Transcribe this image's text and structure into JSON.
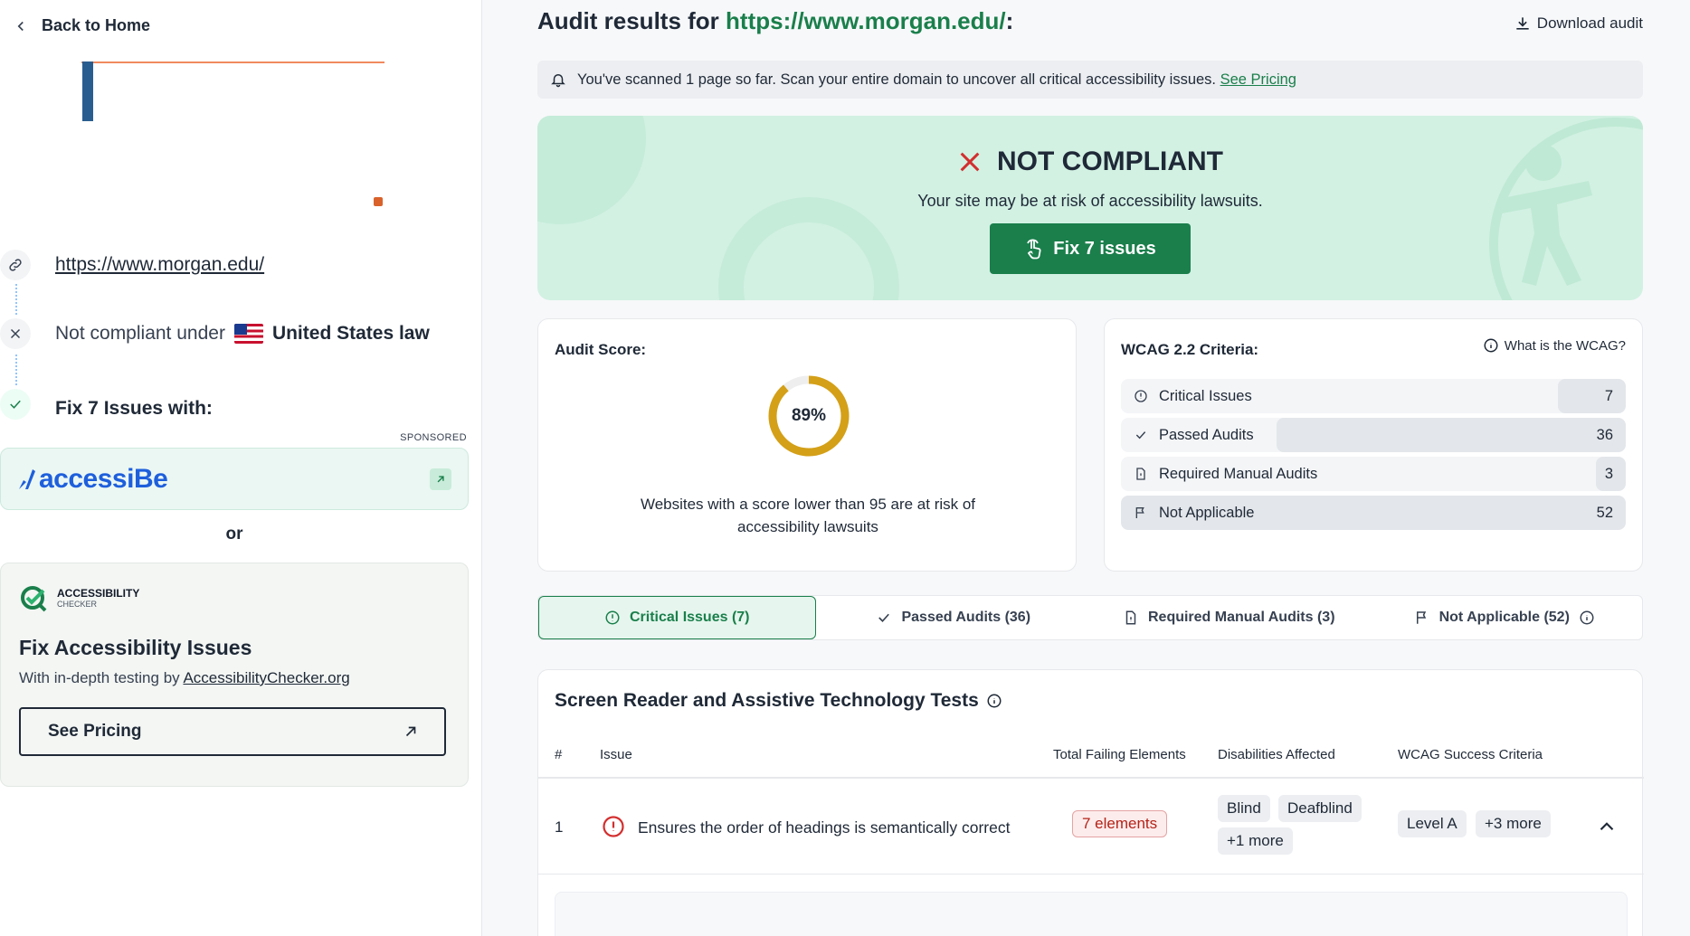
{
  "sidebar": {
    "back_label": "Back to Home",
    "site_url": "https://www.morgan.edu/",
    "compliance_prefix": "Not compliant under",
    "compliance_law": "United States law",
    "fix_with": "Fix 7 Issues with:",
    "sponsored": "SPONSORED",
    "accessibe_logo": "accessiBe",
    "or_label": "or",
    "checker": {
      "brand_line1": "ACCESSIBILITY",
      "brand_line2": "CHECKER",
      "title": "Fix Accessibility Issues",
      "subtitle_prefix": "With in-depth testing by",
      "subtitle_link": "AccessibilityChecker.org",
      "button": "See Pricing"
    }
  },
  "header": {
    "title_prefix": "Audit results for",
    "title_url": "https://www.morgan.edu/",
    "title_suffix": ":",
    "download": "Download audit"
  },
  "notice": {
    "text": "You've scanned 1 page so far. Scan your entire domain to uncover all critical accessibility issues.",
    "link": "See Pricing"
  },
  "hero": {
    "status": "NOT COMPLIANT",
    "risk": "Your site may be at risk of accessibility lawsuits.",
    "button": "Fix 7 issues"
  },
  "score": {
    "title": "Audit Score:",
    "value": 89,
    "label": "89%",
    "note": "Websites with a score lower than 95 are at risk of accessibility lawsuits"
  },
  "wcag": {
    "title": "WCAG 2.2 Criteria:",
    "help": "What is the WCAG?",
    "rows": [
      {
        "label": "Critical Issues",
        "count": "7",
        "icon": "alert-circle-icon"
      },
      {
        "label": "Passed Audits",
        "count": "36",
        "icon": "check-icon"
      },
      {
        "label": "Required Manual Audits",
        "count": "3",
        "icon": "document-icon"
      },
      {
        "label": "Not Applicable",
        "count": "52",
        "icon": "flag-icon"
      }
    ]
  },
  "tabs": [
    {
      "label": "Critical Issues (7)",
      "active": true
    },
    {
      "label": "Passed Audits (36)"
    },
    {
      "label": "Required Manual Audits (3)"
    },
    {
      "label": "Not Applicable (52)"
    }
  ],
  "table": {
    "title": "Screen Reader and Assistive Technology Tests",
    "headers": {
      "num": "#",
      "issue": "Issue",
      "failing": "Total Failing Elements",
      "disabilities": "Disabilities Affected",
      "wcag": "WCAG Success Criteria"
    },
    "rows": [
      {
        "num": "1",
        "issue": "Ensures the order of headings is semantically correct",
        "failing": "7 elements",
        "disabilities": [
          "Blind",
          "Deafblind",
          "+1 more"
        ],
        "criteria": [
          "Level A",
          "+3 more"
        ]
      }
    ]
  },
  "colors": {
    "brand_green": "#1a7f4b",
    "hero_bg": "#d2f1e3",
    "score_ring": "#d4a017",
    "error_red": "#d32f2f"
  }
}
